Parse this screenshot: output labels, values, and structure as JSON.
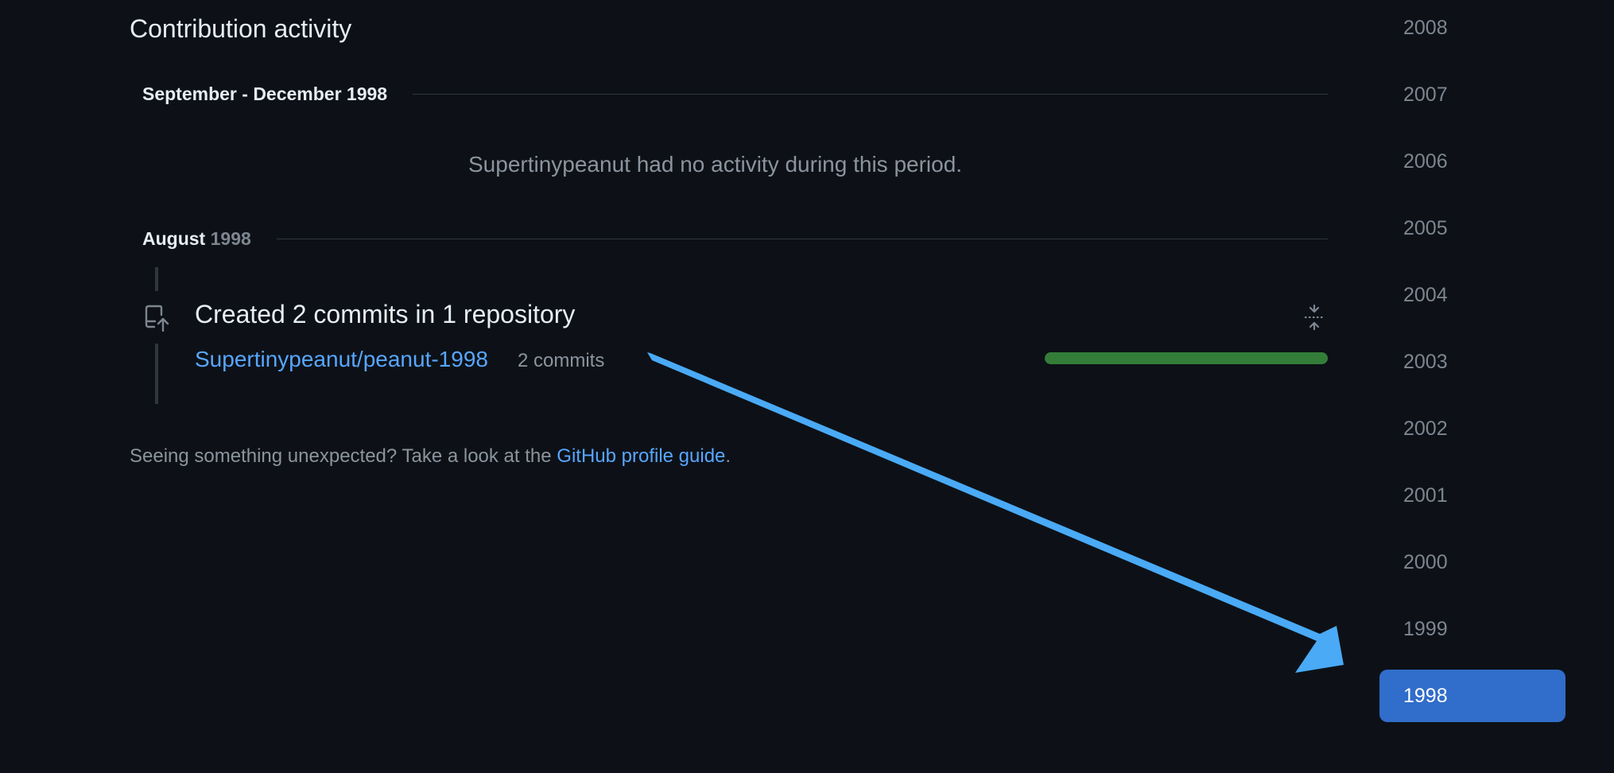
{
  "section": {
    "title": "Contribution activity"
  },
  "periods": [
    {
      "label": "September - December 1998",
      "year": "",
      "message": "Supertinypeanut had no activity during this period."
    },
    {
      "label": "August",
      "year": "1998"
    }
  ],
  "activity": {
    "heading": "Created 2 commits in 1 repository",
    "repo": "Supertinypeanut/peanut-1998",
    "count_label": "2 commits",
    "share": 1.0,
    "bar_color": "#347d39"
  },
  "footer": {
    "prefix": "Seeing something unexpected? Take a look at the ",
    "link": "GitHub profile guide",
    "suffix": "."
  },
  "years": [
    "2008",
    "2007",
    "2006",
    "2005",
    "2004",
    "2003",
    "2002",
    "2001",
    "2000",
    "1999",
    "1998"
  ],
  "selected_year": "1998",
  "annotation": {
    "type": "arrow",
    "color": "#4aaaf5"
  },
  "icons": [
    "repo-push-icon",
    "fold-icon"
  ]
}
